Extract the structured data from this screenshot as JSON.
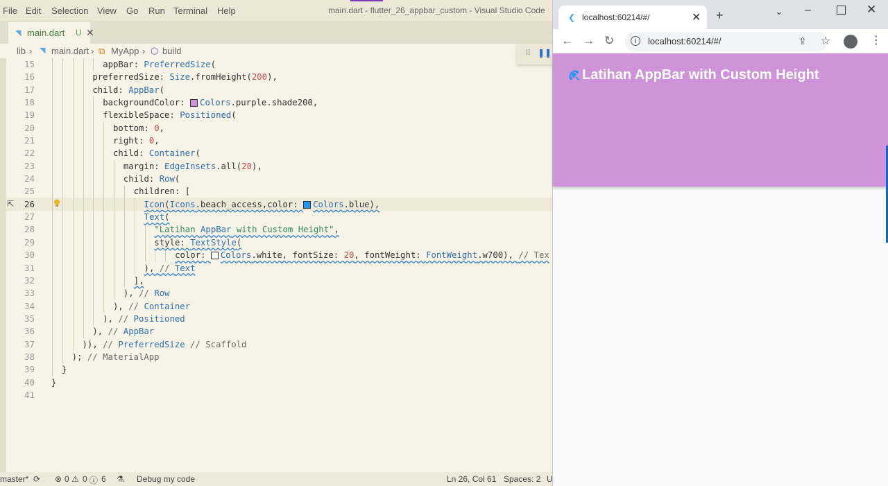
{
  "vscode": {
    "menu": [
      "File",
      "Edit",
      "Selection",
      "View",
      "Go",
      "Run",
      "Terminal",
      "Help"
    ],
    "window_title": "main.dart - flutter_26_appbar_custom - Visual Studio Code",
    "tab": {
      "label": "main.dart",
      "badge": "U"
    },
    "breadcrumb": {
      "folder": "lib",
      "file": "main.dart",
      "class": "MyApp",
      "method": "build"
    },
    "line_numbers": [
      "15",
      "16",
      "17",
      "18",
      "19",
      "20",
      "21",
      "22",
      "23",
      "24",
      "25",
      "26",
      "27",
      "28",
      "29",
      "30",
      "31",
      "32",
      "33",
      "34",
      "35",
      "36",
      "37",
      "38",
      "39",
      "40",
      "41"
    ],
    "active_line": "26",
    "status": {
      "branch": "master*",
      "errors": "0",
      "warnings": "0",
      "infos": "6",
      "debug": "Debug my code",
      "cursor": "Ln 26, Col 61",
      "spaces": "Spaces: 2",
      "extra": "U"
    }
  },
  "code_lines": [
    "appBar: PreferredSize(",
    "preferredSize: Size.fromHeight(200),",
    "child: AppBar(",
    "backgroundColor: Colors.purple.shade200,",
    "flexibleSpace: Positioned(",
    "bottom: 0,",
    "right: 0,",
    "child: Container(",
    "margin: EdgeInsets.all(20),",
    "child: Row(",
    "children: [",
    "Icon(Icons.beach_access,color: Colors.blue),",
    "Text(",
    "\"Latihan AppBar with Custom Height\",",
    "style: TextStyle(",
    "color: Colors.white, fontSize: 20, fontWeight: FontWeight.w700), // Tex",
    "), // Text",
    "],",
    "), // Row",
    "), // Container",
    "), // Positioned",
    "), // AppBar",
    ")), // PreferredSize // Scaffold",
    "); // MaterialApp",
    "}",
    "}",
    ""
  ],
  "colors": {
    "appbar_bg": "#ce93d8",
    "appbar_text": "#ffffff",
    "icon_blue": "#2196f3"
  },
  "browser": {
    "tab_title": "localhost:60214/#/",
    "url": "localhost:60214/#/",
    "new_tab": "+",
    "appbar_title": "Latihan AppBar with Custom Height",
    "appbar_icon": "beach-access-icon"
  }
}
